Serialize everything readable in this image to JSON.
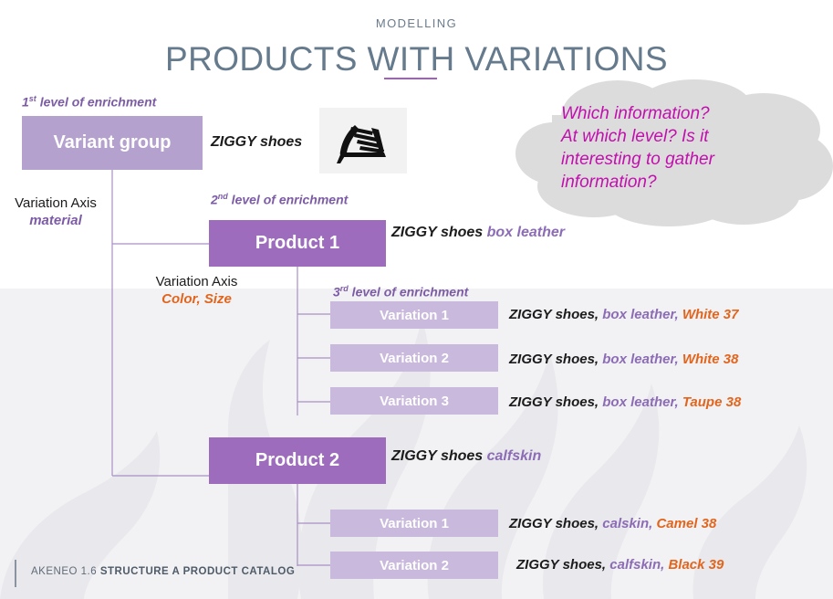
{
  "header": {
    "eyebrow": "MODELLING",
    "title": "PRODUCTS WITH VARIATIONS"
  },
  "enrichment_levels": {
    "level1_prefix": "1",
    "level1_sup": "st",
    "level1_rest": " level of enrichment",
    "level2_prefix": "2",
    "level2_sup": "nd",
    "level2_rest": " level of enrichment",
    "level3_prefix": "3",
    "level3_sup": "rd",
    "level3_rest": " level of enrichment"
  },
  "variation_axes": [
    {
      "title": "Variation Axis",
      "value": "material",
      "color": "#7d5ca6"
    },
    {
      "title": "Variation Axis",
      "value": "Color, Size",
      "color": "#e2651d"
    }
  ],
  "nodes": {
    "variant_group": {
      "label": "Variant group",
      "sku_base": "ZIGGY shoes",
      "sku_material": "",
      "sku_color": ""
    },
    "product1": {
      "label": "Product 1",
      "sku_base": "ZIGGY shoes ",
      "sku_material": "box leather",
      "sku_color": ""
    },
    "product2": {
      "label": "Product 2",
      "sku_base": "ZIGGY shoes ",
      "sku_material": "calfskin",
      "sku_color": ""
    }
  },
  "product1_variations": [
    {
      "label": "Variation 1",
      "sku_base": "ZIGGY shoes, ",
      "sku_material": "box leather, ",
      "sku_color": "White 37"
    },
    {
      "label": "Variation 2",
      "sku_base": "ZIGGY shoes, ",
      "sku_material": "box leather, ",
      "sku_color": "White 38"
    },
    {
      "label": "Variation 3",
      "sku_base": "ZIGGY shoes, ",
      "sku_material": "box leather, ",
      "sku_color": "Taupe 38"
    }
  ],
  "product2_variations": [
    {
      "label": "Variation 1",
      "sku_base": "ZIGGY shoes, ",
      "sku_material": "calskin, ",
      "sku_color": "Camel 38"
    },
    {
      "label": "Variation 2",
      "sku_base": "ZIGGY shoes, ",
      "sku_material": "calfskin, ",
      "sku_color": "Black 39"
    }
  ],
  "thought_bubble": {
    "line1": "Which information?",
    "line2": "At which level? Is it",
    "line3": "interesting to gather",
    "line4": "information?"
  },
  "media": {
    "shoe_thumbnail": "high-heel-sandal-icon"
  },
  "footer": {
    "prefix": "AKENEO 1.6 ",
    "bold": "STRUCTURE A PRODUCT CATALOG"
  },
  "colors": {
    "variant_group_box": "#b4a1cd",
    "product_box": "#9d6cbd",
    "variation_box": "#c9b9dc",
    "title": "#657a8c",
    "accent_rule": "#a45ec2",
    "material_text": "#8b6cb5",
    "color_text": "#e2651d",
    "cloud_fill": "#dcdcdc",
    "cloud_text": "#c20fae",
    "background_wash": "#f2f2f4"
  }
}
